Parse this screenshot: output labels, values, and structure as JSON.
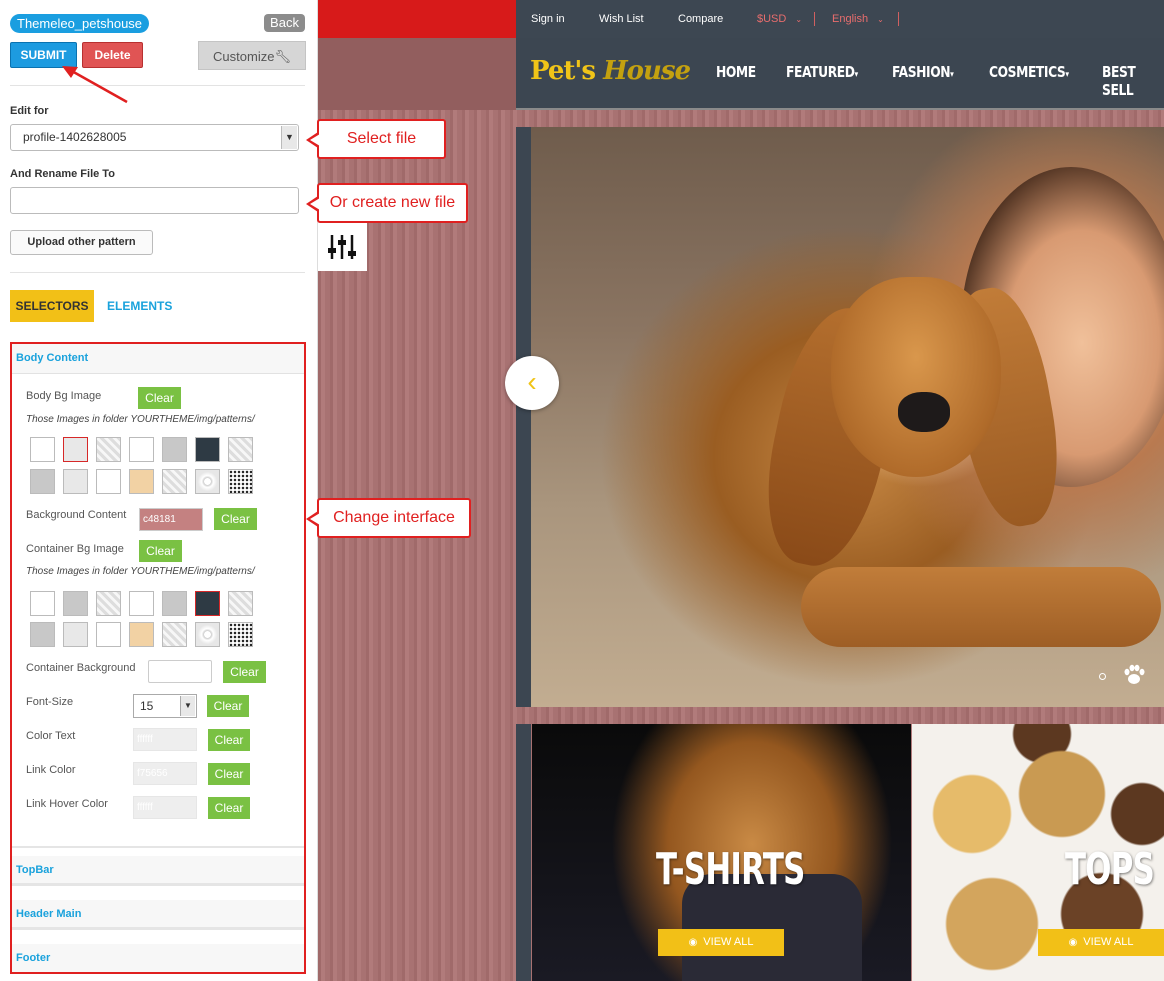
{
  "panel": {
    "theme_name": "Themeleo_petshouse",
    "back_label": "Back",
    "submit_label": "SUBMIT",
    "delete_label": "Delete",
    "customize_label": "Customize",
    "edit_for_label": "Edit for",
    "edit_for_value": "profile-1402628005",
    "rename_label": "And Rename File To",
    "rename_value": "",
    "upload_label": "Upload other pattern",
    "tabs": {
      "selectors": "SELECTORS",
      "elements": "ELEMENTS"
    },
    "sections": {
      "body_content": "Body Content",
      "topbar": "TopBar",
      "header_main": "Header Main",
      "footer": "Footer"
    },
    "body": {
      "body_bg_image_label": "Body Bg Image",
      "patterns_hint": "Those Images in folder YOURTHEME/img/patterns/",
      "background_content_label": "Background Content",
      "background_content_value": "c48181",
      "container_bg_image_label": "Container Bg Image",
      "container_patterns_hint": "Those Images in folder YOURTHEME/img/patterns/",
      "container_background_label": "Container Background",
      "container_background_value": "",
      "font_size_label": "Font-Size",
      "font_size_value": "15",
      "color_text_label": "Color Text",
      "color_text_value": "ffffff",
      "link_color_label": "Link Color",
      "link_color_value": "f75656",
      "link_hover_label": "Link Hover Color",
      "link_hover_value": "ffffff",
      "clear_label": "Clear"
    }
  },
  "callouts": {
    "select_file": "Select file",
    "create_file": "Or create new file",
    "change_interface": "Change interface"
  },
  "site": {
    "top_links": [
      "Sign in",
      "Wish List",
      "Compare"
    ],
    "currency": "$USD",
    "language": "English",
    "logo_main": "Pet's",
    "logo_house": "House",
    "nav": [
      "HOME",
      "FEATURED",
      "FASHION",
      "COSMETICS",
      "BEST SELL"
    ],
    "tiles": [
      {
        "title": "T-SHIRTS",
        "button": "VIEW ALL"
      },
      {
        "title": "TOPS",
        "button": "VIEW ALL"
      }
    ]
  },
  "colors": {
    "accent_blue": "#1a9ee0",
    "accent_yellow": "#f2c017",
    "clear_green": "#7ac143",
    "annotation_red": "#e02020",
    "background_content": "#c48181"
  }
}
